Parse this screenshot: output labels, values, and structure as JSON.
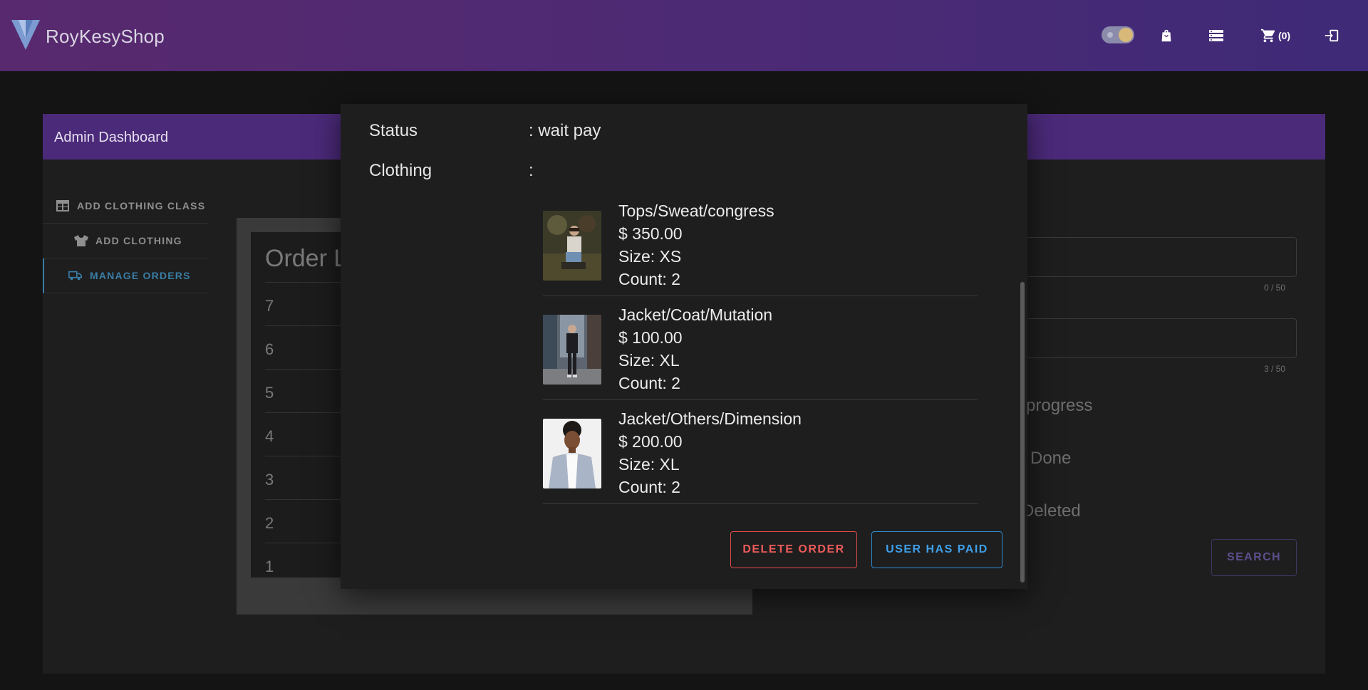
{
  "header": {
    "brand": "RoyKesyShop",
    "cart_count": "(0)",
    "icons": [
      "vuetify-logo-icon",
      "theme-toggle",
      "shopping-bag-icon",
      "storage-icon",
      "cart-icon",
      "logout-icon"
    ]
  },
  "dashboard": {
    "title": "Admin Dashboard",
    "sidebar": [
      {
        "label": "ADD CLOTHING CLASS",
        "icon": "table-icon",
        "active": false
      },
      {
        "label": "ADD CLOTHING",
        "icon": "tshirt-icon",
        "active": false
      },
      {
        "label": "MANAGE ORDERS",
        "icon": "truck-icon",
        "active": true
      }
    ],
    "order_list": {
      "title": "Order L",
      "rows": [
        "7",
        "6",
        "5",
        "4",
        "3",
        "2",
        "1"
      ]
    },
    "filters": {
      "counter_1": "0 / 50",
      "counter_2": "3 / 50",
      "status_labels": [
        "progress",
        "Done",
        "Deleted"
      ],
      "search_label": "SEARCH"
    }
  },
  "dialog": {
    "status_label": "Status",
    "status_value": ": wait pay",
    "clothing_label": "Clothing",
    "clothing_value": ":",
    "items": [
      {
        "name": "Tops/Sweat/congress",
        "price": "$   350.00",
        "size": "Size: XS",
        "count": "Count: 2"
      },
      {
        "name": "Jacket/Coat/Mutation",
        "price": "$   100.00",
        "size": "Size: XL",
        "count": "Count: 2"
      },
      {
        "name": "Jacket/Others/Dimension",
        "price": "$   200.00",
        "size": "Size: XL",
        "count": "Count: 2"
      }
    ],
    "delete_label": "DELETE ORDER",
    "paid_label": "USER HAS PAID"
  },
  "colors": {
    "header_start": "#58296e",
    "header_end": "#3e2a77",
    "accent_purple": "#4b2a7a",
    "delete_red": "#ef5b5b",
    "paid_blue": "#3fa0ea",
    "active_nav": "#3a7ea6"
  }
}
